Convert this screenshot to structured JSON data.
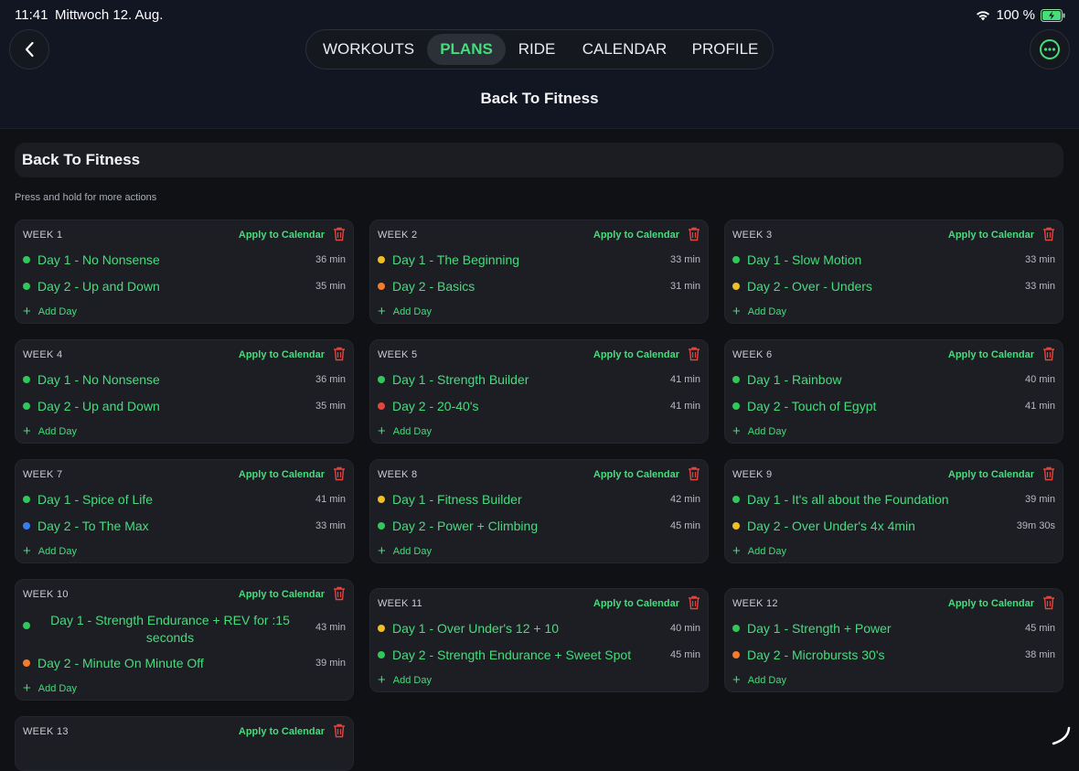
{
  "status": {
    "time": "11:41",
    "date": "Mittwoch 12. Aug.",
    "battery": "100 %"
  },
  "nav": {
    "back_icon": "chevron-left-icon",
    "more_icon": "ellipsis-circle-icon",
    "tabs": [
      {
        "label": "WORKOUTS"
      },
      {
        "label": "PLANS",
        "active": true
      },
      {
        "label": "RIDE"
      },
      {
        "label": "CALENDAR"
      },
      {
        "label": "PROFILE"
      }
    ]
  },
  "page_title": "Back To Fitness",
  "plan_name": "Back To Fitness",
  "hint": "Press and hold for more actions",
  "apply_label": "Apply to Calendar",
  "add_day_label": "Add Day",
  "colors": {
    "accent": "#46dc7c",
    "trash": "#e0443e",
    "green": "#30c85a",
    "yellow": "#f0bf24",
    "orange": "#f47b2a",
    "red": "#e2453e",
    "blue": "#3b7cf5"
  },
  "weeks": [
    {
      "label": "WEEK 1",
      "days": [
        {
          "name": "Day 1 - No Nonsense",
          "duration": "36 min",
          "dot": "green"
        },
        {
          "name": "Day 2 - Up and Down",
          "duration": "35 min",
          "dot": "green"
        }
      ]
    },
    {
      "label": "WEEK 2",
      "days": [
        {
          "name": "Day 1 - The Beginning",
          "duration": "33 min",
          "dot": "yellow"
        },
        {
          "name": "Day 2 - Basics",
          "duration": "31 min",
          "dot": "orange"
        }
      ]
    },
    {
      "label": "WEEK 3",
      "days": [
        {
          "name": "Day 1 - Slow Motion",
          "duration": "33 min",
          "dot": "green"
        },
        {
          "name": "Day 2 - Over - Unders",
          "duration": "33 min",
          "dot": "yellow"
        }
      ]
    },
    {
      "label": "WEEK 4",
      "days": [
        {
          "name": "Day 1 - No Nonsense",
          "duration": "36 min",
          "dot": "green"
        },
        {
          "name": "Day 2 - Up and Down",
          "duration": "35 min",
          "dot": "green"
        }
      ]
    },
    {
      "label": "WEEK 5",
      "days": [
        {
          "name": "Day 1 - Strength Builder",
          "duration": "41 min",
          "dot": "green"
        },
        {
          "name": "Day 2 - 20-40's",
          "duration": "41 min",
          "dot": "red"
        }
      ]
    },
    {
      "label": "WEEK 6",
      "days": [
        {
          "name": "Day 1 - Rainbow",
          "duration": "40 min",
          "dot": "green"
        },
        {
          "name": "Day 2 - Touch of Egypt",
          "duration": "41 min",
          "dot": "green"
        }
      ]
    },
    {
      "label": "WEEK 7",
      "days": [
        {
          "name": "Day 1 - Spice of Life",
          "duration": "41 min",
          "dot": "green"
        },
        {
          "name": "Day 2 - To The Max",
          "duration": "33 min",
          "dot": "blue"
        }
      ]
    },
    {
      "label": "WEEK 8",
      "days": [
        {
          "name": "Day 1 - Fitness Builder",
          "duration": "42 min",
          "dot": "yellow"
        },
        {
          "name": "Day 2 - Power + Climbing",
          "duration": "45 min",
          "dot": "green"
        }
      ]
    },
    {
      "label": "WEEK 9",
      "days": [
        {
          "name": "Day 1 - It's all about the Foundation",
          "duration": "39 min",
          "dot": "green"
        },
        {
          "name": "Day 2 - Over Under's 4x 4min",
          "duration": "39m 30s",
          "dot": "yellow"
        }
      ]
    },
    {
      "label": "WEEK 10",
      "days": [
        {
          "name": "Day 1 - Strength Endurance + REV for :15 seconds",
          "duration": "43 min",
          "dot": "green"
        },
        {
          "name": "Day 2 - Minute On Minute Off",
          "duration": "39 min",
          "dot": "orange"
        }
      ]
    },
    {
      "label": "WEEK 11",
      "days": [
        {
          "name": "Day 1 - Over Under's 12 + 10",
          "duration": "40 min",
          "dot": "yellow"
        },
        {
          "name": "Day 2 - Strength Endurance + Sweet Spot",
          "duration": "45 min",
          "dot": "green"
        }
      ]
    },
    {
      "label": "WEEK 12",
      "days": [
        {
          "name": "Day 1 - Strength + Power",
          "duration": "45 min",
          "dot": "green"
        },
        {
          "name": "Day 2 - Microbursts 30's",
          "duration": "38 min",
          "dot": "orange"
        }
      ]
    },
    {
      "label": "WEEK 13",
      "days": []
    }
  ]
}
